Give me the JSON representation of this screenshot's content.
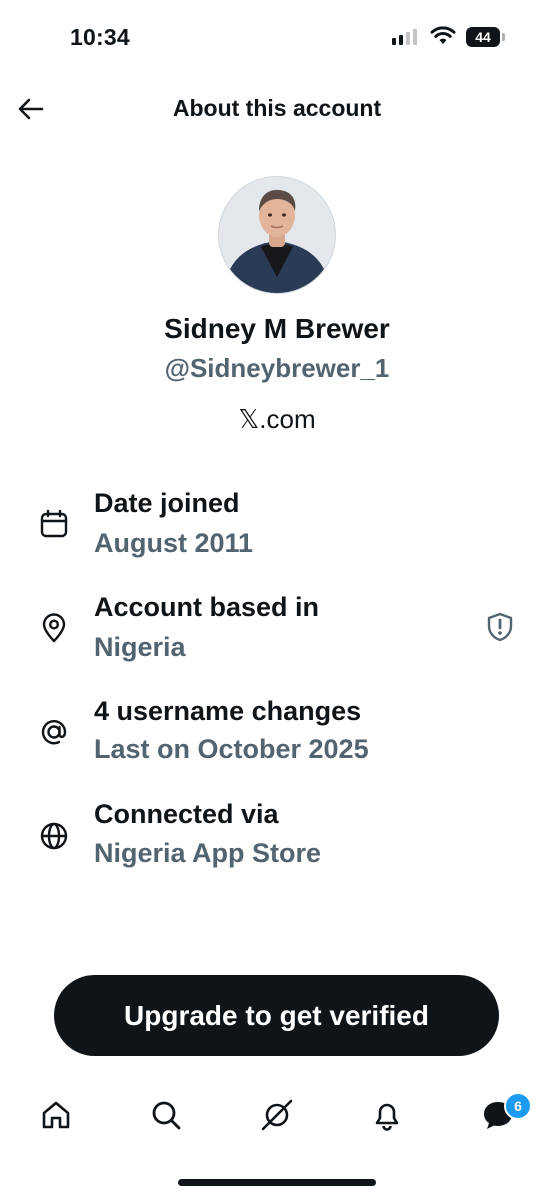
{
  "status_bar": {
    "time": "10:34",
    "battery": "44"
  },
  "header": {
    "title": "About this account",
    "back_icon": "arrow-left-icon"
  },
  "profile": {
    "name": "Sidney M Brewer",
    "handle": "@Sidneybrewer_1",
    "site": "𝕏.com"
  },
  "info": [
    {
      "icon": "calendar-icon",
      "title": "Date joined",
      "value": "August 2011"
    },
    {
      "icon": "location-pin-icon",
      "title": "Account based in",
      "value": "Nigeria"
    },
    {
      "icon": "at-sign-icon",
      "title": "4 username changes",
      "value": "Last on October 2025"
    },
    {
      "icon": "globe-icon",
      "title": "Connected via",
      "value": "Nigeria App Store"
    }
  ],
  "upgrade_button": {
    "label": "Upgrade to get verified"
  },
  "tab_bar": {
    "items": [
      "home-icon",
      "search-icon",
      "grok-icon",
      "bell-icon",
      "messages-icon"
    ],
    "messages_badge": "6"
  },
  "colors": {
    "text": "#0f1419",
    "secondary": "#536471",
    "accent": "#1d9bf0"
  }
}
